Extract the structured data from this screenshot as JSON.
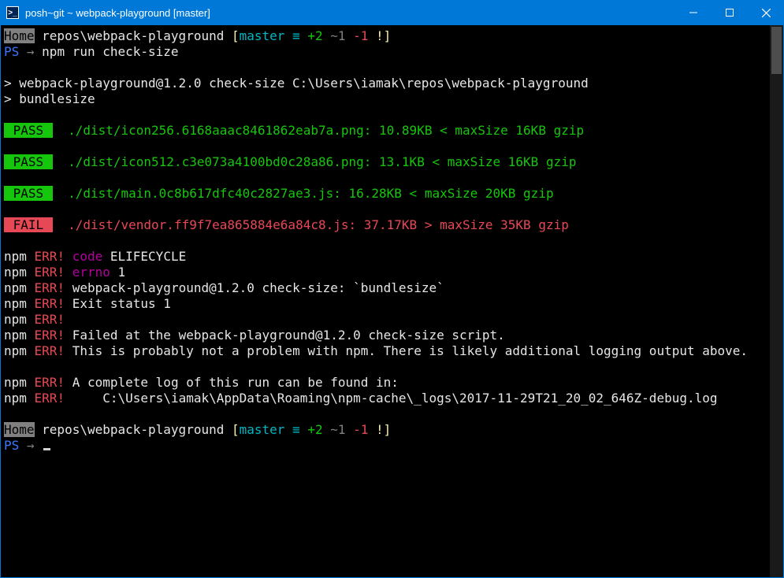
{
  "window": {
    "title": "posh~git ~ webpack-playground [master]"
  },
  "prompt1": {
    "home": "Home",
    "path": " repos\\webpack-playground ",
    "branch_open": "[",
    "branch": "master",
    "eq": " ≡ ",
    "plus": "+2",
    "space1": " ",
    "tilde": "~1",
    "space2": " ",
    "minus": "-1",
    "bang": " !",
    "branch_close": "]"
  },
  "ps_line": {
    "ps": "PS",
    "arrow": " → ",
    "cmd": "npm run check-size"
  },
  "npm_run1": "> webpack-playground@1.2.0 check-size C:\\Users\\iamak\\repos\\webpack-playground",
  "npm_run2": "> bundlesize",
  "results": [
    {
      "status": "PASS",
      "text": "  ./dist/icon256.6168aaac8461862eab7a.png: 10.89KB < maxSize 16KB gzip"
    },
    {
      "status": "PASS",
      "text": "  ./dist/icon512.c3e073a4100bd0c28a86.png: 13.1KB < maxSize 16KB gzip"
    },
    {
      "status": "PASS",
      "text": "  ./dist/main.0c8b617dfc40c2827ae3.js: 16.28KB < maxSize 20KB gzip"
    },
    {
      "status": "FAIL",
      "text": "  ./dist/vendor.ff9f7ea865884e6a84c8.js: 37.17KB > maxSize 35KB gzip"
    }
  ],
  "err": {
    "npm": "npm",
    "ERR": " ERR!",
    "l1a": " code",
    "l1b": " ELIFECYCLE",
    "l2a": " errno",
    "l2b": " 1",
    "l3": " webpack-playground@1.2.0 check-size: `bundlesize`",
    "l4": " Exit status 1",
    "l6": " Failed at the webpack-playground@1.2.0 check-size script.",
    "l7": " This is probably not a problem with npm. There is likely additional logging output above.",
    "l9": " A complete log of this run can be found in:",
    "l10": "     C:\\Users\\iamak\\AppData\\Roaming\\npm-cache\\_logs\\2017-11-29T21_20_02_646Z-debug.log"
  },
  "ps_line2": {
    "ps": "PS",
    "arrow": " → "
  }
}
